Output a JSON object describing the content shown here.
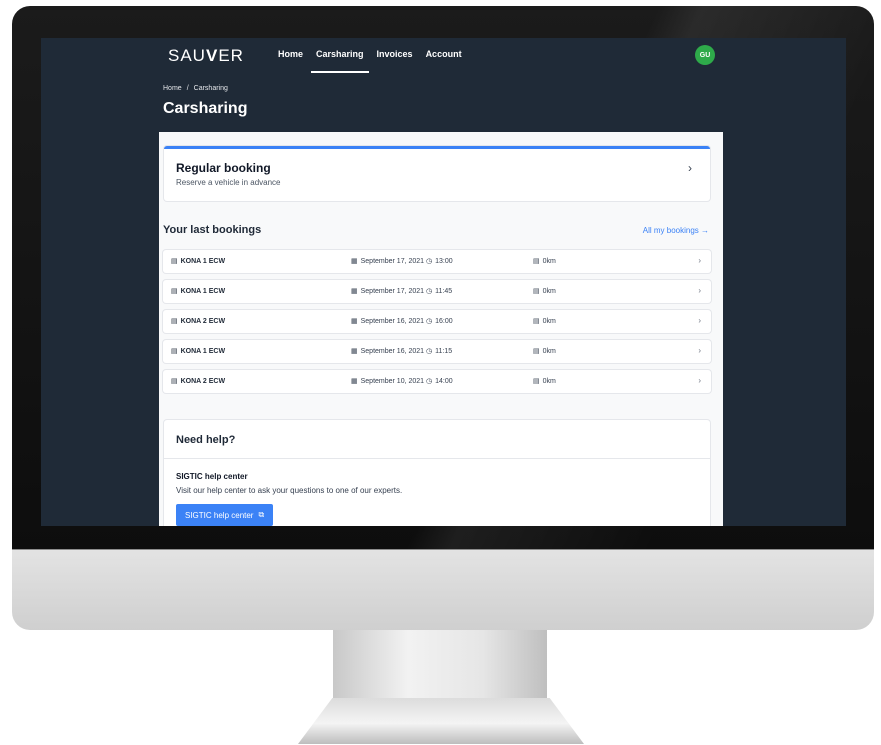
{
  "header": {
    "logo_prefix": "SAU",
    "logo_bold": "V",
    "logo_suffix": "ER",
    "nav": [
      {
        "label": "Home"
      },
      {
        "label": "Carsharing",
        "active": true
      },
      {
        "label": "Invoices"
      },
      {
        "label": "Account"
      }
    ],
    "avatar_initials": "GU",
    "avatar_color": "#2eaa4a"
  },
  "breadcrumb": {
    "home": "Home",
    "separator": "/",
    "current": "Carsharing"
  },
  "page_title": "Carsharing",
  "booking_card": {
    "title": "Regular booking",
    "subtitle": "Reserve a vehicle in advance",
    "chevron_icon": "chevron-right-icon"
  },
  "last_bookings": {
    "title": "Your last bookings",
    "all_link": "All my bookings →",
    "rows": [
      {
        "car": "KONA 1 ECW",
        "date": "September 17, 2021",
        "time": "13:00",
        "distance": "0km"
      },
      {
        "car": "KONA 1 ECW",
        "date": "September 17, 2021",
        "time": "11:45",
        "distance": "0km"
      },
      {
        "car": "KONA 2 ECW",
        "date": "September 16, 2021",
        "time": "16:00",
        "distance": "0km"
      },
      {
        "car": "KONA 1 ECW",
        "date": "September 16, 2021",
        "time": "11:15",
        "distance": "0km"
      },
      {
        "car": "KONA 2 ECW",
        "date": "September 10, 2021",
        "time": "14:00",
        "distance": "0km"
      }
    ]
  },
  "help": {
    "title": "Need help?",
    "subtitle": "SIGTIC help center",
    "text": "Visit our help center to ask your questions to one of our experts.",
    "button_label": "SIGTIC help center"
  },
  "colors": {
    "screen_bg": "#1f2a37",
    "accent": "#3b82f6"
  }
}
